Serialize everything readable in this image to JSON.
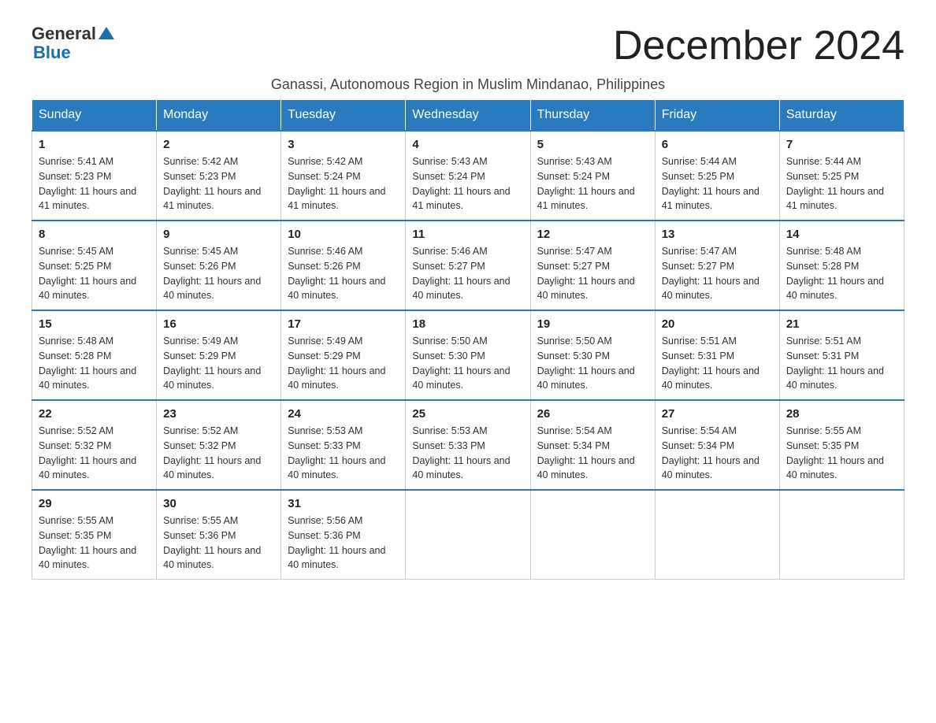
{
  "logo": {
    "text_general": "General",
    "text_blue": "Blue",
    "aria": "GeneralBlue logo"
  },
  "header": {
    "month_title": "December 2024",
    "subtitle": "Ganassi, Autonomous Region in Muslim Mindanao, Philippines"
  },
  "weekdays": [
    "Sunday",
    "Monday",
    "Tuesday",
    "Wednesday",
    "Thursday",
    "Friday",
    "Saturday"
  ],
  "weeks": [
    [
      {
        "day": "1",
        "sunrise": "5:41 AM",
        "sunset": "5:23 PM",
        "daylight": "11 hours and 41 minutes."
      },
      {
        "day": "2",
        "sunrise": "5:42 AM",
        "sunset": "5:23 PM",
        "daylight": "11 hours and 41 minutes."
      },
      {
        "day": "3",
        "sunrise": "5:42 AM",
        "sunset": "5:24 PM",
        "daylight": "11 hours and 41 minutes."
      },
      {
        "day": "4",
        "sunrise": "5:43 AM",
        "sunset": "5:24 PM",
        "daylight": "11 hours and 41 minutes."
      },
      {
        "day": "5",
        "sunrise": "5:43 AM",
        "sunset": "5:24 PM",
        "daylight": "11 hours and 41 minutes."
      },
      {
        "day": "6",
        "sunrise": "5:44 AM",
        "sunset": "5:25 PM",
        "daylight": "11 hours and 41 minutes."
      },
      {
        "day": "7",
        "sunrise": "5:44 AM",
        "sunset": "5:25 PM",
        "daylight": "11 hours and 41 minutes."
      }
    ],
    [
      {
        "day": "8",
        "sunrise": "5:45 AM",
        "sunset": "5:25 PM",
        "daylight": "11 hours and 40 minutes."
      },
      {
        "day": "9",
        "sunrise": "5:45 AM",
        "sunset": "5:26 PM",
        "daylight": "11 hours and 40 minutes."
      },
      {
        "day": "10",
        "sunrise": "5:46 AM",
        "sunset": "5:26 PM",
        "daylight": "11 hours and 40 minutes."
      },
      {
        "day": "11",
        "sunrise": "5:46 AM",
        "sunset": "5:27 PM",
        "daylight": "11 hours and 40 minutes."
      },
      {
        "day": "12",
        "sunrise": "5:47 AM",
        "sunset": "5:27 PM",
        "daylight": "11 hours and 40 minutes."
      },
      {
        "day": "13",
        "sunrise": "5:47 AM",
        "sunset": "5:27 PM",
        "daylight": "11 hours and 40 minutes."
      },
      {
        "day": "14",
        "sunrise": "5:48 AM",
        "sunset": "5:28 PM",
        "daylight": "11 hours and 40 minutes."
      }
    ],
    [
      {
        "day": "15",
        "sunrise": "5:48 AM",
        "sunset": "5:28 PM",
        "daylight": "11 hours and 40 minutes."
      },
      {
        "day": "16",
        "sunrise": "5:49 AM",
        "sunset": "5:29 PM",
        "daylight": "11 hours and 40 minutes."
      },
      {
        "day": "17",
        "sunrise": "5:49 AM",
        "sunset": "5:29 PM",
        "daylight": "11 hours and 40 minutes."
      },
      {
        "day": "18",
        "sunrise": "5:50 AM",
        "sunset": "5:30 PM",
        "daylight": "11 hours and 40 minutes."
      },
      {
        "day": "19",
        "sunrise": "5:50 AM",
        "sunset": "5:30 PM",
        "daylight": "11 hours and 40 minutes."
      },
      {
        "day": "20",
        "sunrise": "5:51 AM",
        "sunset": "5:31 PM",
        "daylight": "11 hours and 40 minutes."
      },
      {
        "day": "21",
        "sunrise": "5:51 AM",
        "sunset": "5:31 PM",
        "daylight": "11 hours and 40 minutes."
      }
    ],
    [
      {
        "day": "22",
        "sunrise": "5:52 AM",
        "sunset": "5:32 PM",
        "daylight": "11 hours and 40 minutes."
      },
      {
        "day": "23",
        "sunrise": "5:52 AM",
        "sunset": "5:32 PM",
        "daylight": "11 hours and 40 minutes."
      },
      {
        "day": "24",
        "sunrise": "5:53 AM",
        "sunset": "5:33 PM",
        "daylight": "11 hours and 40 minutes."
      },
      {
        "day": "25",
        "sunrise": "5:53 AM",
        "sunset": "5:33 PM",
        "daylight": "11 hours and 40 minutes."
      },
      {
        "day": "26",
        "sunrise": "5:54 AM",
        "sunset": "5:34 PM",
        "daylight": "11 hours and 40 minutes."
      },
      {
        "day": "27",
        "sunrise": "5:54 AM",
        "sunset": "5:34 PM",
        "daylight": "11 hours and 40 minutes."
      },
      {
        "day": "28",
        "sunrise": "5:55 AM",
        "sunset": "5:35 PM",
        "daylight": "11 hours and 40 minutes."
      }
    ],
    [
      {
        "day": "29",
        "sunrise": "5:55 AM",
        "sunset": "5:35 PM",
        "daylight": "11 hours and 40 minutes."
      },
      {
        "day": "30",
        "sunrise": "5:55 AM",
        "sunset": "5:36 PM",
        "daylight": "11 hours and 40 minutes."
      },
      {
        "day": "31",
        "sunrise": "5:56 AM",
        "sunset": "5:36 PM",
        "daylight": "11 hours and 40 minutes."
      },
      null,
      null,
      null,
      null
    ]
  ]
}
